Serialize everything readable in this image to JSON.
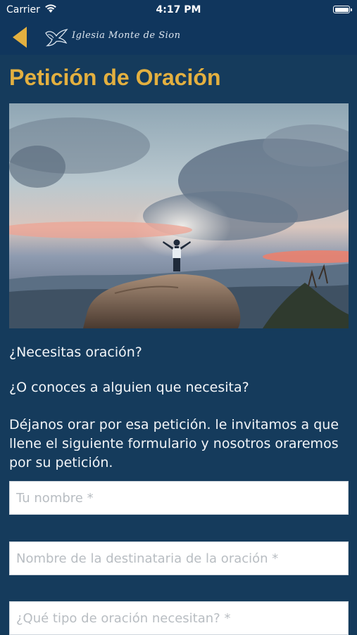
{
  "status_bar": {
    "carrier": "Carrier",
    "time": "4:17 PM",
    "wifi_icon": "wifi-icon",
    "battery_icon": "battery-icon"
  },
  "nav": {
    "back_icon": "chevron-left-icon",
    "logo_text": "Iglesia Monte de Sion",
    "accent_color": "#E3B040",
    "bar_color": "#10365D"
  },
  "page": {
    "title": "Petición de Oración",
    "hero_image": "person-on-rock-sunset-photo",
    "paragraphs": [
      "¿Necesitas oración?",
      "¿O conoces a alguien que necesita?",
      "Déjanos orar por esa petición. le invitamos a que llene el siguiente formulario y nosotros oraremos por su petición."
    ]
  },
  "form": {
    "name_placeholder": "Tu nombre *",
    "recipient_placeholder": "Nombre de la destinataria de la oración *",
    "prayer_type_placeholder": "¿Qué tipo de oración necesitan? *"
  }
}
